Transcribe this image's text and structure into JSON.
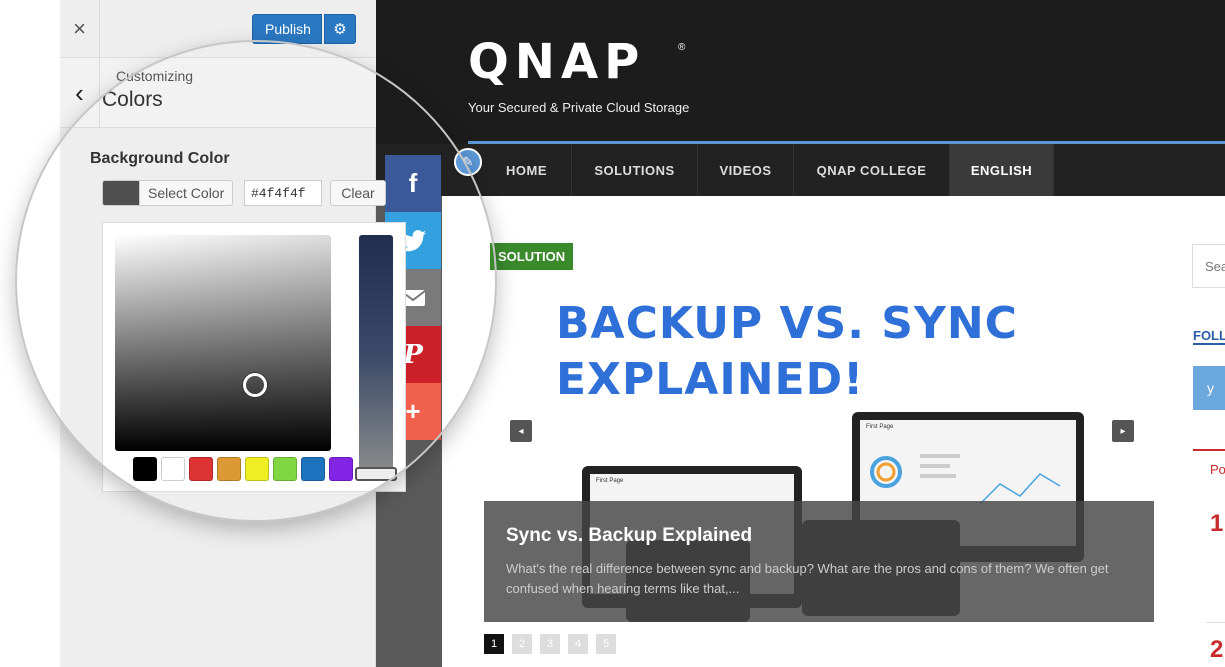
{
  "customizer": {
    "close": "×",
    "publish_label": "Publish",
    "gear": "⚙",
    "back": "‹",
    "breadcrumb": "Customizing",
    "section_title": "Colors",
    "bg_label": "Background Color",
    "select_color_label": "Select Color",
    "hex_value": "#4f4f4f",
    "clear_label": "Clear",
    "current_color": "#4f4f4f",
    "palette": [
      "#000000",
      "#ffffff",
      "#dd3333",
      "#dd9933",
      "#eeee22",
      "#81d742",
      "#1e73be",
      "#8224e3"
    ]
  },
  "site": {
    "logo": "QNAP",
    "logo_mark": "®",
    "tagline": "Your Secured & Private Cloud Storage",
    "nav": [
      {
        "label": "HOME"
      },
      {
        "label": "SOLUTIONS"
      },
      {
        "label": "VIDEOS"
      },
      {
        "label": "QNAP COLLEGE"
      },
      {
        "label": "ENGLISH"
      }
    ],
    "share": [
      {
        "icon": "facebook-icon",
        "glyph": "f",
        "color": "#3b5998"
      },
      {
        "icon": "twitter-icon",
        "glyph": "🐦",
        "color": "#33a1e0"
      },
      {
        "icon": "email-icon",
        "glyph": "✉",
        "color": "#7a7a7a"
      },
      {
        "icon": "pinterest-icon",
        "glyph": "P",
        "color": "#cb2027"
      },
      {
        "icon": "more-icon",
        "glyph": "+",
        "color": "#f0604d"
      }
    ],
    "tag": "SOLUTION",
    "hero_line1": "BACKUP VS. SYNC",
    "hero_line2": "EXPLAINED!",
    "prev": "◂",
    "next": "▸",
    "caption_title": "Sync vs. Backup Explained",
    "caption_text": "What's the real difference between sync and backup? What are the pros and cons of them? We often get confused when hearing terms like that,...",
    "pages": [
      "1",
      "2",
      "3",
      "4",
      "5"
    ],
    "search_placeholder": "Sea",
    "follow_label": "FOLL",
    "popular_label": "Po",
    "rank1": "1",
    "rank2": "2",
    "device_screen_title": "First Page"
  }
}
